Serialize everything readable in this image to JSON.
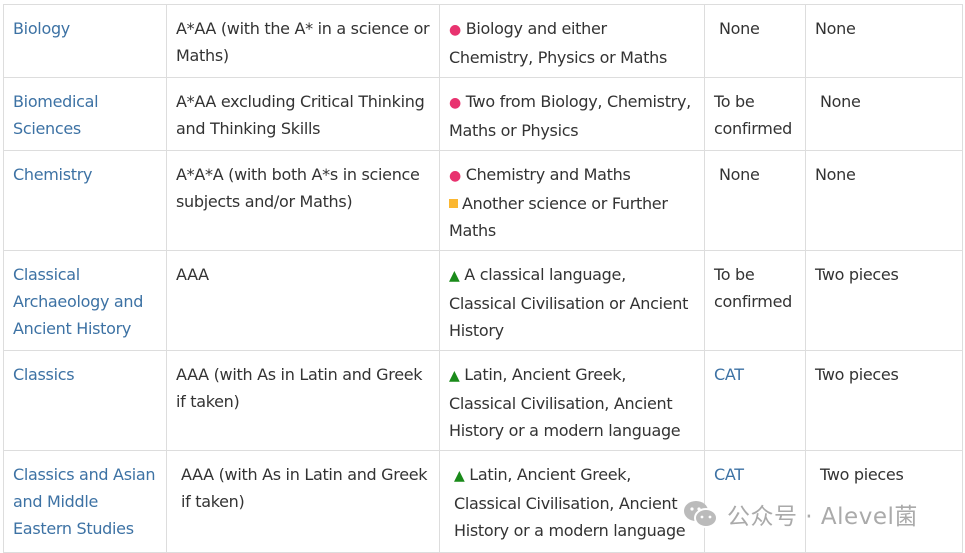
{
  "rows": [
    {
      "subject": "Biology",
      "grades": "A*AA (with the A* in a science or Maths)",
      "subjects": [
        {
          "marker": "pink-dot",
          "text": "Biology and either Chemistry, Physics or Maths"
        }
      ],
      "test": "None",
      "written": "None"
    },
    {
      "subject": "Biomedical Sciences",
      "grades": "A*AA excluding Critical Thinking and Thinking Skills",
      "subjects": [
        {
          "marker": "pink-dot",
          "text": "Two from Biology, Chemistry, Maths or Physics"
        }
      ],
      "test": "To be confirmed",
      "written": "None"
    },
    {
      "subject": "Chemistry",
      "grades": "A*A*A (with both A*s in science subjects and/or Maths)",
      "subjects": [
        {
          "marker": "pink-dot",
          "text": "Chemistry and Maths"
        },
        {
          "marker": "orange-square",
          "text": "Another science or Further Maths"
        }
      ],
      "test": "None",
      "written": "None"
    },
    {
      "subject": "Classical Archaeology and Ancient History",
      "grades": "AAA",
      "subjects": [
        {
          "marker": "green-triangle",
          "text": "A classical language, Classical Civilisation or Ancient History"
        }
      ],
      "test": "To be confirmed",
      "written": "Two pieces"
    },
    {
      "subject": "Classics",
      "grades": "AAA (with As in Latin and Greek if taken)",
      "subjects": [
        {
          "marker": "green-triangle",
          "text": "Latin, Ancient Greek, Classical Civilisation, Ancient History or a modern language"
        }
      ],
      "test": "CAT",
      "test_link": true,
      "written": "Two pieces"
    },
    {
      "subject": "Classics and Asian and Middle Eastern Studies",
      "grades": "AAA (with As in Latin and Greek if taken)",
      "subjects": [
        {
          "marker": "green-triangle",
          "text": "Latin, Ancient Greek, Classical Civilisation, Ancient History or a modern language"
        }
      ],
      "test": "CAT",
      "test_link": true,
      "written": "Two pieces"
    }
  ],
  "colors": {
    "link": "#3d72a4",
    "pink-dot": "#e8336f",
    "orange-square": "#fbb731",
    "green-triangle": "#1a8a1a"
  },
  "watermark": {
    "icon": "wechat-icon",
    "text": "公众号 · Alevel菌"
  }
}
